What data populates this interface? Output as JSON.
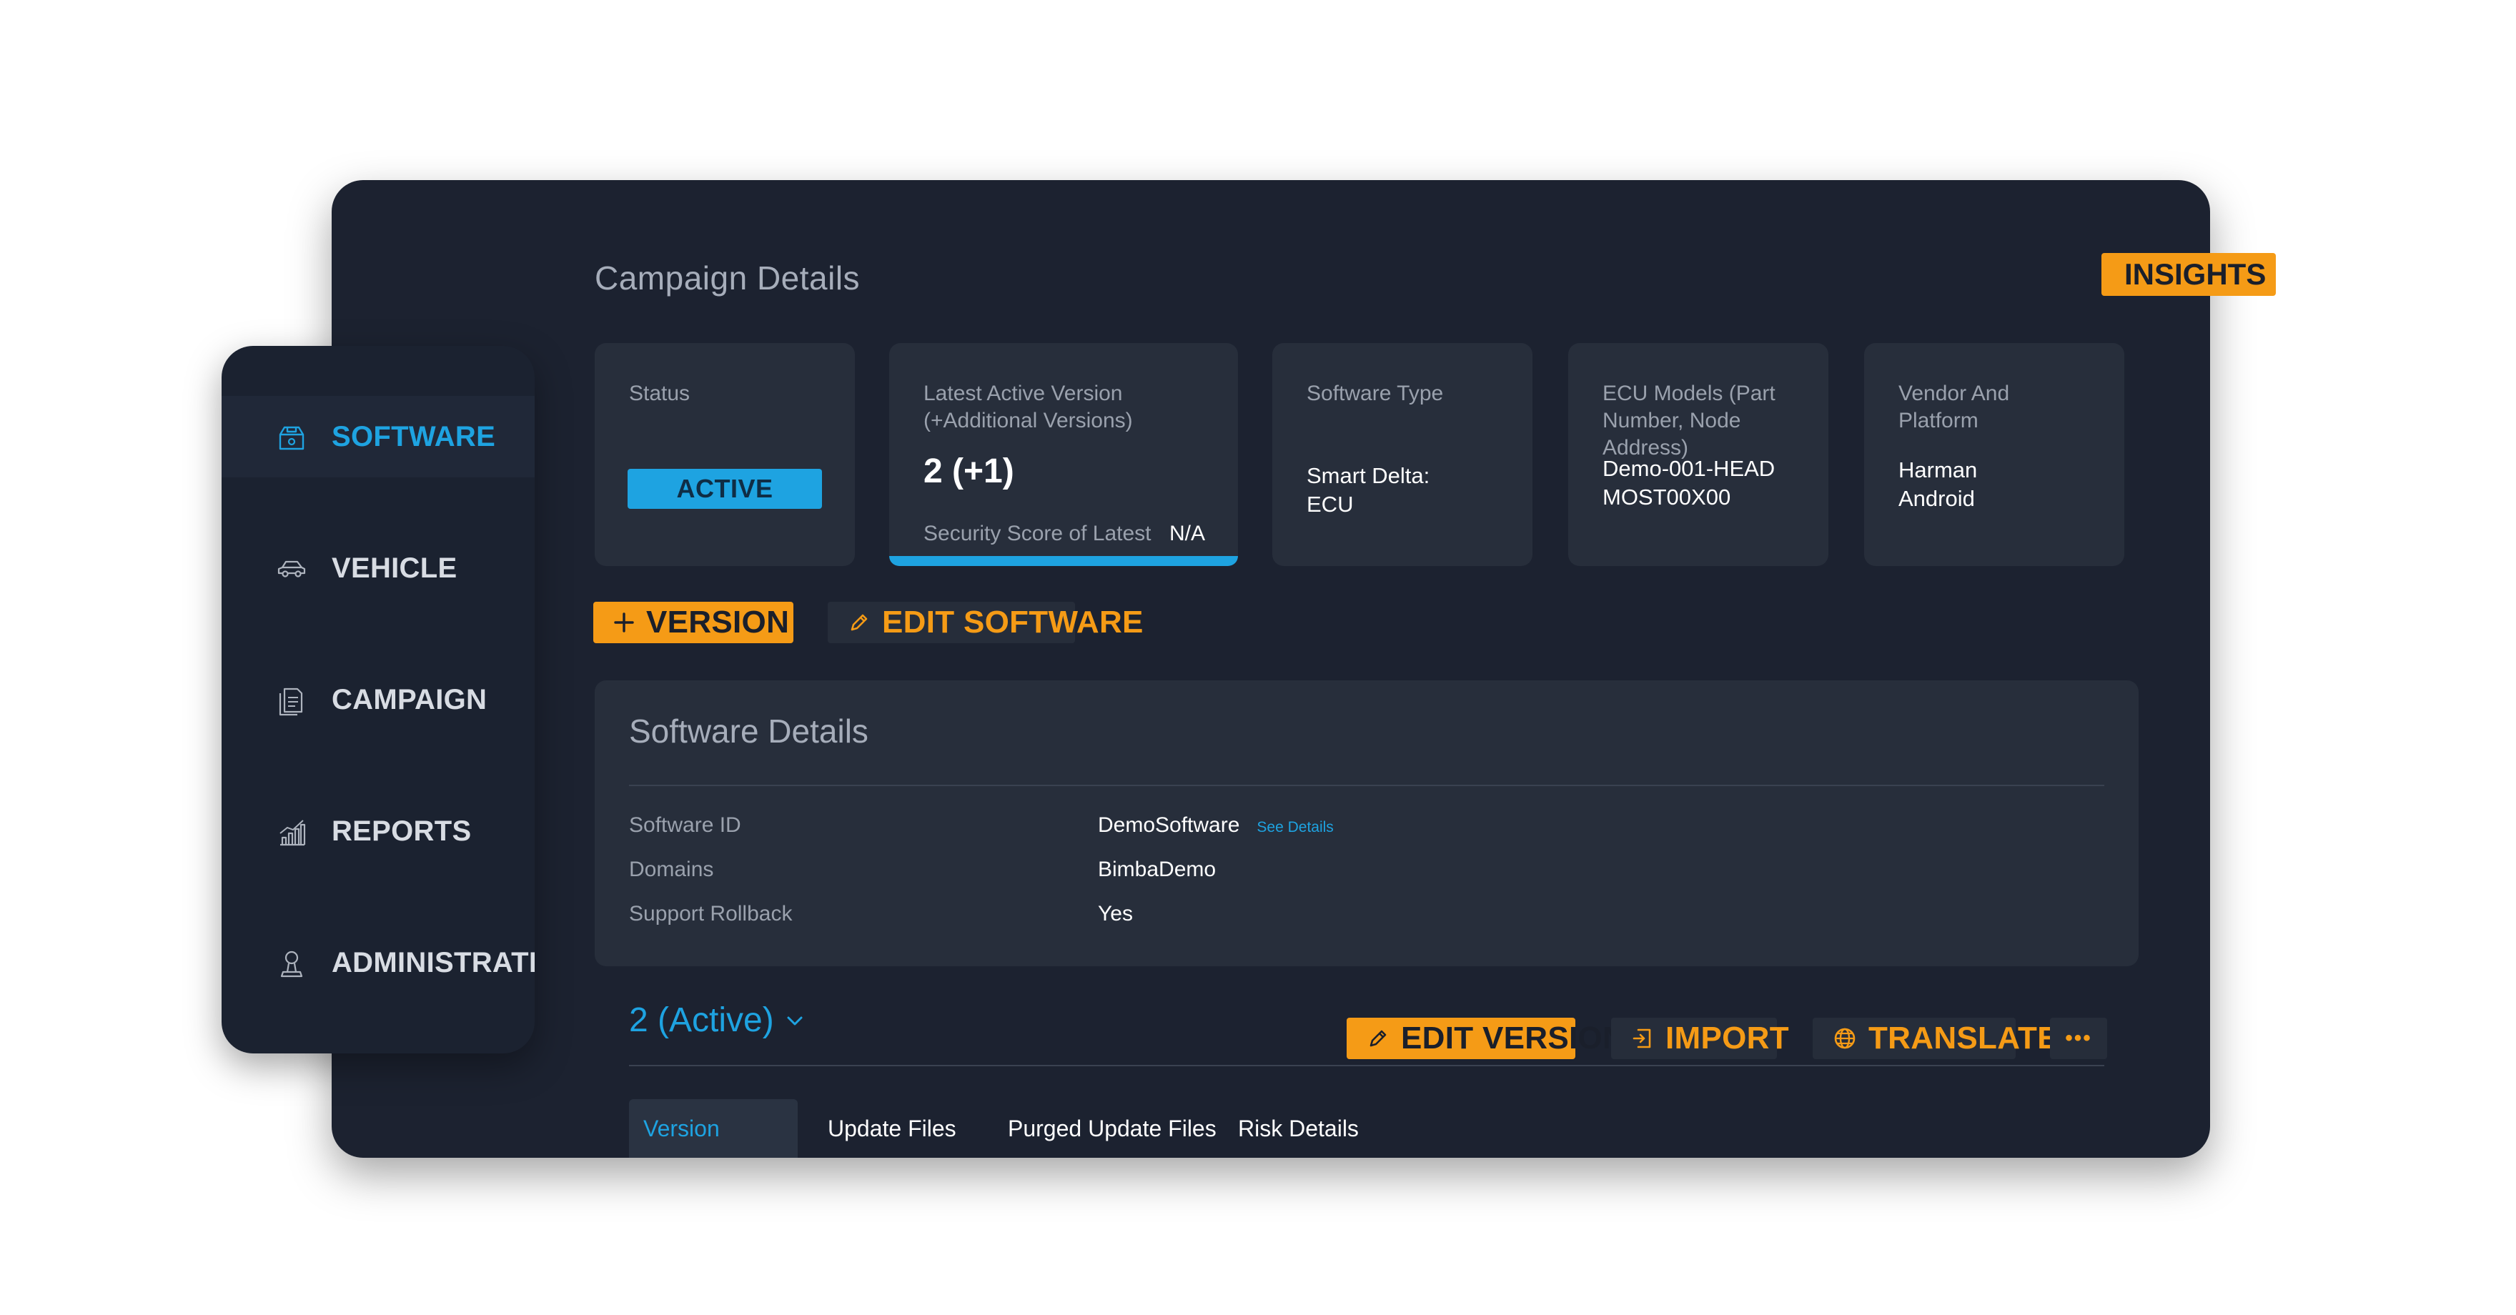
{
  "page_title": "Campaign Details",
  "insights_label": "INSIGHTS",
  "sidebar": {
    "items": [
      {
        "label": "SOFTWARE",
        "icon": "software-package-icon",
        "active": true
      },
      {
        "label": "VEHICLE",
        "icon": "car-icon",
        "active": false
      },
      {
        "label": "CAMPAIGN",
        "icon": "campaign-document-icon",
        "active": false
      },
      {
        "label": "REPORTS",
        "icon": "bar-chart-icon",
        "active": false
      },
      {
        "label": "ADMINISTRATION",
        "icon": "user-admin-icon",
        "active": false
      }
    ]
  },
  "cards": {
    "status": {
      "label": "Status",
      "value": "ACTIVE"
    },
    "latest": {
      "label_line1": "Latest Active Version",
      "label_line2": "(+Additional Versions)",
      "value": "2 (+1)",
      "security_label": "Security Score of Latest",
      "security_value": "N/A"
    },
    "software_type": {
      "label": "Software Type",
      "value_line1": "Smart Delta:",
      "value_line2": "ECU"
    },
    "ecu_models": {
      "label_line1": "ECU Models (Part",
      "label_line2": "Number, Node Address)",
      "value_line1": "Demo-001-HEAD",
      "value_line2": "MOST00X00"
    },
    "vendor": {
      "label_line1": "Vendor And",
      "label_line2": "Platform",
      "value_line1": "Harman",
      "value_line2": "Android"
    }
  },
  "actions": {
    "version": "VERSION",
    "edit_software": "EDIT SOFTWARE"
  },
  "software_details": {
    "title": "Software Details",
    "rows": [
      {
        "label": "Software ID",
        "value": "DemoSoftware",
        "link": "See Details"
      },
      {
        "label": "Domains",
        "value": "BimbaDemo"
      },
      {
        "label": "Support Rollback",
        "value": "Yes"
      }
    ]
  },
  "version_bar": {
    "selected": "2 (Active)",
    "edit_version": "EDIT VERSION",
    "import": "IMPORT",
    "translate": "TRANSLATE",
    "more": "•••"
  },
  "tabs": [
    {
      "label": "Version Details",
      "active": true
    },
    {
      "label": "Update Files",
      "active": false
    },
    {
      "label": "Purged Update Files",
      "active": false
    },
    {
      "label": "Risk Details",
      "active": false
    }
  ],
  "colors": {
    "accent": "#1ea3e1",
    "orange": "#f59b16",
    "bg": "#1c2230",
    "card": "#272e3b"
  }
}
